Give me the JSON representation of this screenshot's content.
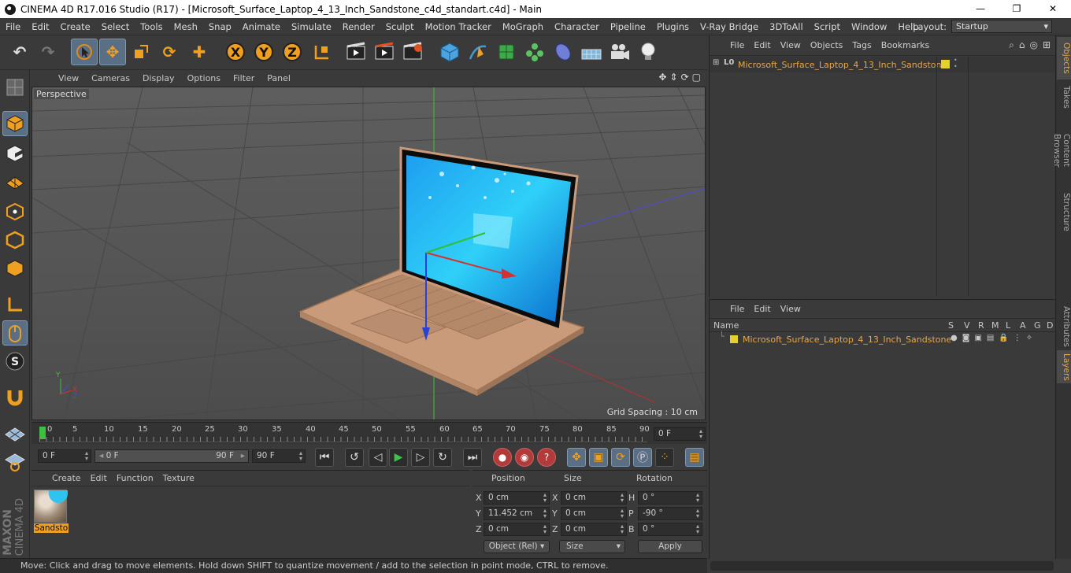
{
  "window": {
    "title": "CINEMA 4D R17.016 Studio (R17) - [Microsoft_Surface_Laptop_4_13_Inch_Sandstone_c4d_standart.c4d] - Main",
    "minimize": "—",
    "maximize": "❐",
    "close": "✕"
  },
  "menu": {
    "items": [
      "File",
      "Edit",
      "Create",
      "Select",
      "Tools",
      "Mesh",
      "Snap",
      "Animate",
      "Simulate",
      "Render",
      "Sculpt",
      "Motion Tracker",
      "MoGraph",
      "Character",
      "Pipeline",
      "Plugins",
      "V-Ray Bridge",
      "3DToAll",
      "Script",
      "Window",
      "Help"
    ],
    "layout_label": "Layout:",
    "layout_value": "Startup"
  },
  "toolbar": {
    "axis_x": "X",
    "axis_y": "Y",
    "axis_z": "Z"
  },
  "viewport": {
    "menu": [
      "View",
      "Cameras",
      "Display",
      "Options",
      "Filter",
      "Panel"
    ],
    "label": "Perspective",
    "grid_spacing": "Grid Spacing : 10 cm",
    "axis_x": "X",
    "axis_y": "Y",
    "axis_z": "Z"
  },
  "timeline": {
    "ticks": [
      "0",
      "5",
      "10",
      "15",
      "20",
      "25",
      "30",
      "35",
      "40",
      "45",
      "50",
      "55",
      "60",
      "65",
      "70",
      "75",
      "80",
      "85",
      "90"
    ],
    "current_frame": "0 F"
  },
  "playback": {
    "start": "0 F",
    "range_start": "0 F",
    "range_end": "90 F",
    "end": "90 F"
  },
  "material_manager": {
    "menu": [
      "Create",
      "Edit",
      "Function",
      "Texture"
    ],
    "material_name": "Sandsto"
  },
  "coordinates": {
    "headers": [
      "Position",
      "Size",
      "Rotation"
    ],
    "rows": [
      {
        "axis": "X",
        "pos": "0 cm",
        "saxis": "X",
        "size": "0 cm",
        "raxis": "H",
        "rot": "0 °"
      },
      {
        "axis": "Y",
        "pos": "11.452 cm",
        "saxis": "Y",
        "size": "0 cm",
        "raxis": "P",
        "rot": "-90 °"
      },
      {
        "axis": "Z",
        "pos": "0 cm",
        "saxis": "Z",
        "size": "0 cm",
        "raxis": "B",
        "rot": "0 °"
      }
    ],
    "mode": "Object (Rel)",
    "size_mode": "Size",
    "apply": "Apply"
  },
  "objects_panel": {
    "menu": [
      "File",
      "Edit",
      "View",
      "Objects",
      "Tags",
      "Bookmarks"
    ],
    "object_name": "Microsoft_Surface_Laptop_4_13_Inch_Sandstone"
  },
  "layers_panel": {
    "menu": [
      "File",
      "Edit",
      "View"
    ],
    "columns": {
      "name": "Name",
      "cols": [
        "S",
        "V",
        "R",
        "M",
        "L",
        "A",
        "G",
        "D"
      ]
    },
    "layer_name": "Microsoft_Surface_Laptop_4_13_Inch_Sandstone"
  },
  "right_tabs": {
    "top": [
      "Objects",
      "Takes",
      "Content Browser",
      "Structure"
    ],
    "bottom": [
      "Attributes",
      "Layers"
    ]
  },
  "status": {
    "text": "Move: Click and drag to move elements. Hold down SHIFT to quantize movement / add to the selection in point mode, CTRL to remove."
  },
  "branding": {
    "maxon": "MAXON",
    "product": "CINEMA 4D"
  },
  "colors": {
    "accent": "#e6a64c",
    "selected": "#5a6e84",
    "layer_yellow": "#e5d12b"
  }
}
